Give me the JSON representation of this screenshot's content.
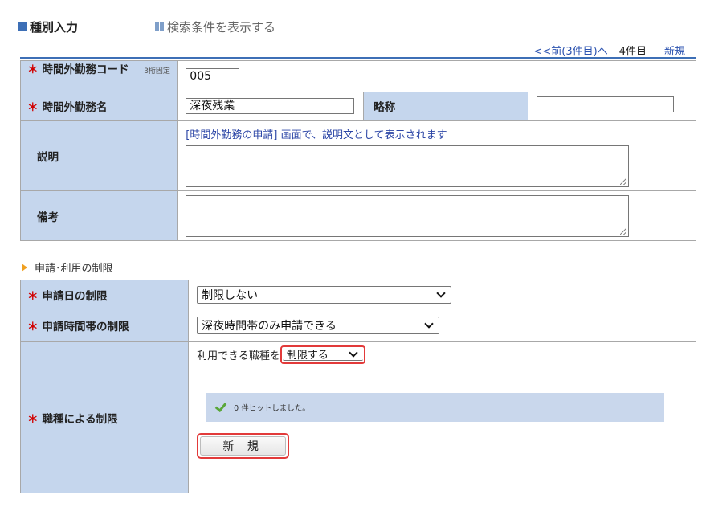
{
  "tabs": {
    "active": "種別入力",
    "inactive": "検索条件を表示する"
  },
  "nav": {
    "prev": "<<前(3件目)へ",
    "count": "4件目",
    "new": "新規"
  },
  "form": {
    "code_label": "時間外勤務コード",
    "code_hint": "3桁固定",
    "code_value": "005",
    "name_label": "時間外勤務名",
    "name_value": "深夜残業",
    "abbr_label": "略称",
    "abbr_value": "",
    "desc_label": "説明",
    "desc_hint": "[時間外勤務の申請] 画面で、説明文として表示されます",
    "desc_value": "",
    "note_label": "備考",
    "note_value": ""
  },
  "section": {
    "title": "申請･利用の制限"
  },
  "limits": {
    "date_label": "申請日の制限",
    "date_value": "制限しない",
    "time_label": "申請時間帯の制限",
    "time_value": "深夜時間帯のみ申請できる",
    "job_label": "職種による制限",
    "job_prompt": "利用できる職種を",
    "job_value": "制限する",
    "hit_text": "0 件ヒットしました。",
    "new_button": "新 規"
  },
  "required_mark": "＊",
  "colors": {
    "accent": "#3d6fb6",
    "label_bg": "#c5d6ed",
    "required": "#d10000",
    "highlight": "#e23a3a"
  }
}
